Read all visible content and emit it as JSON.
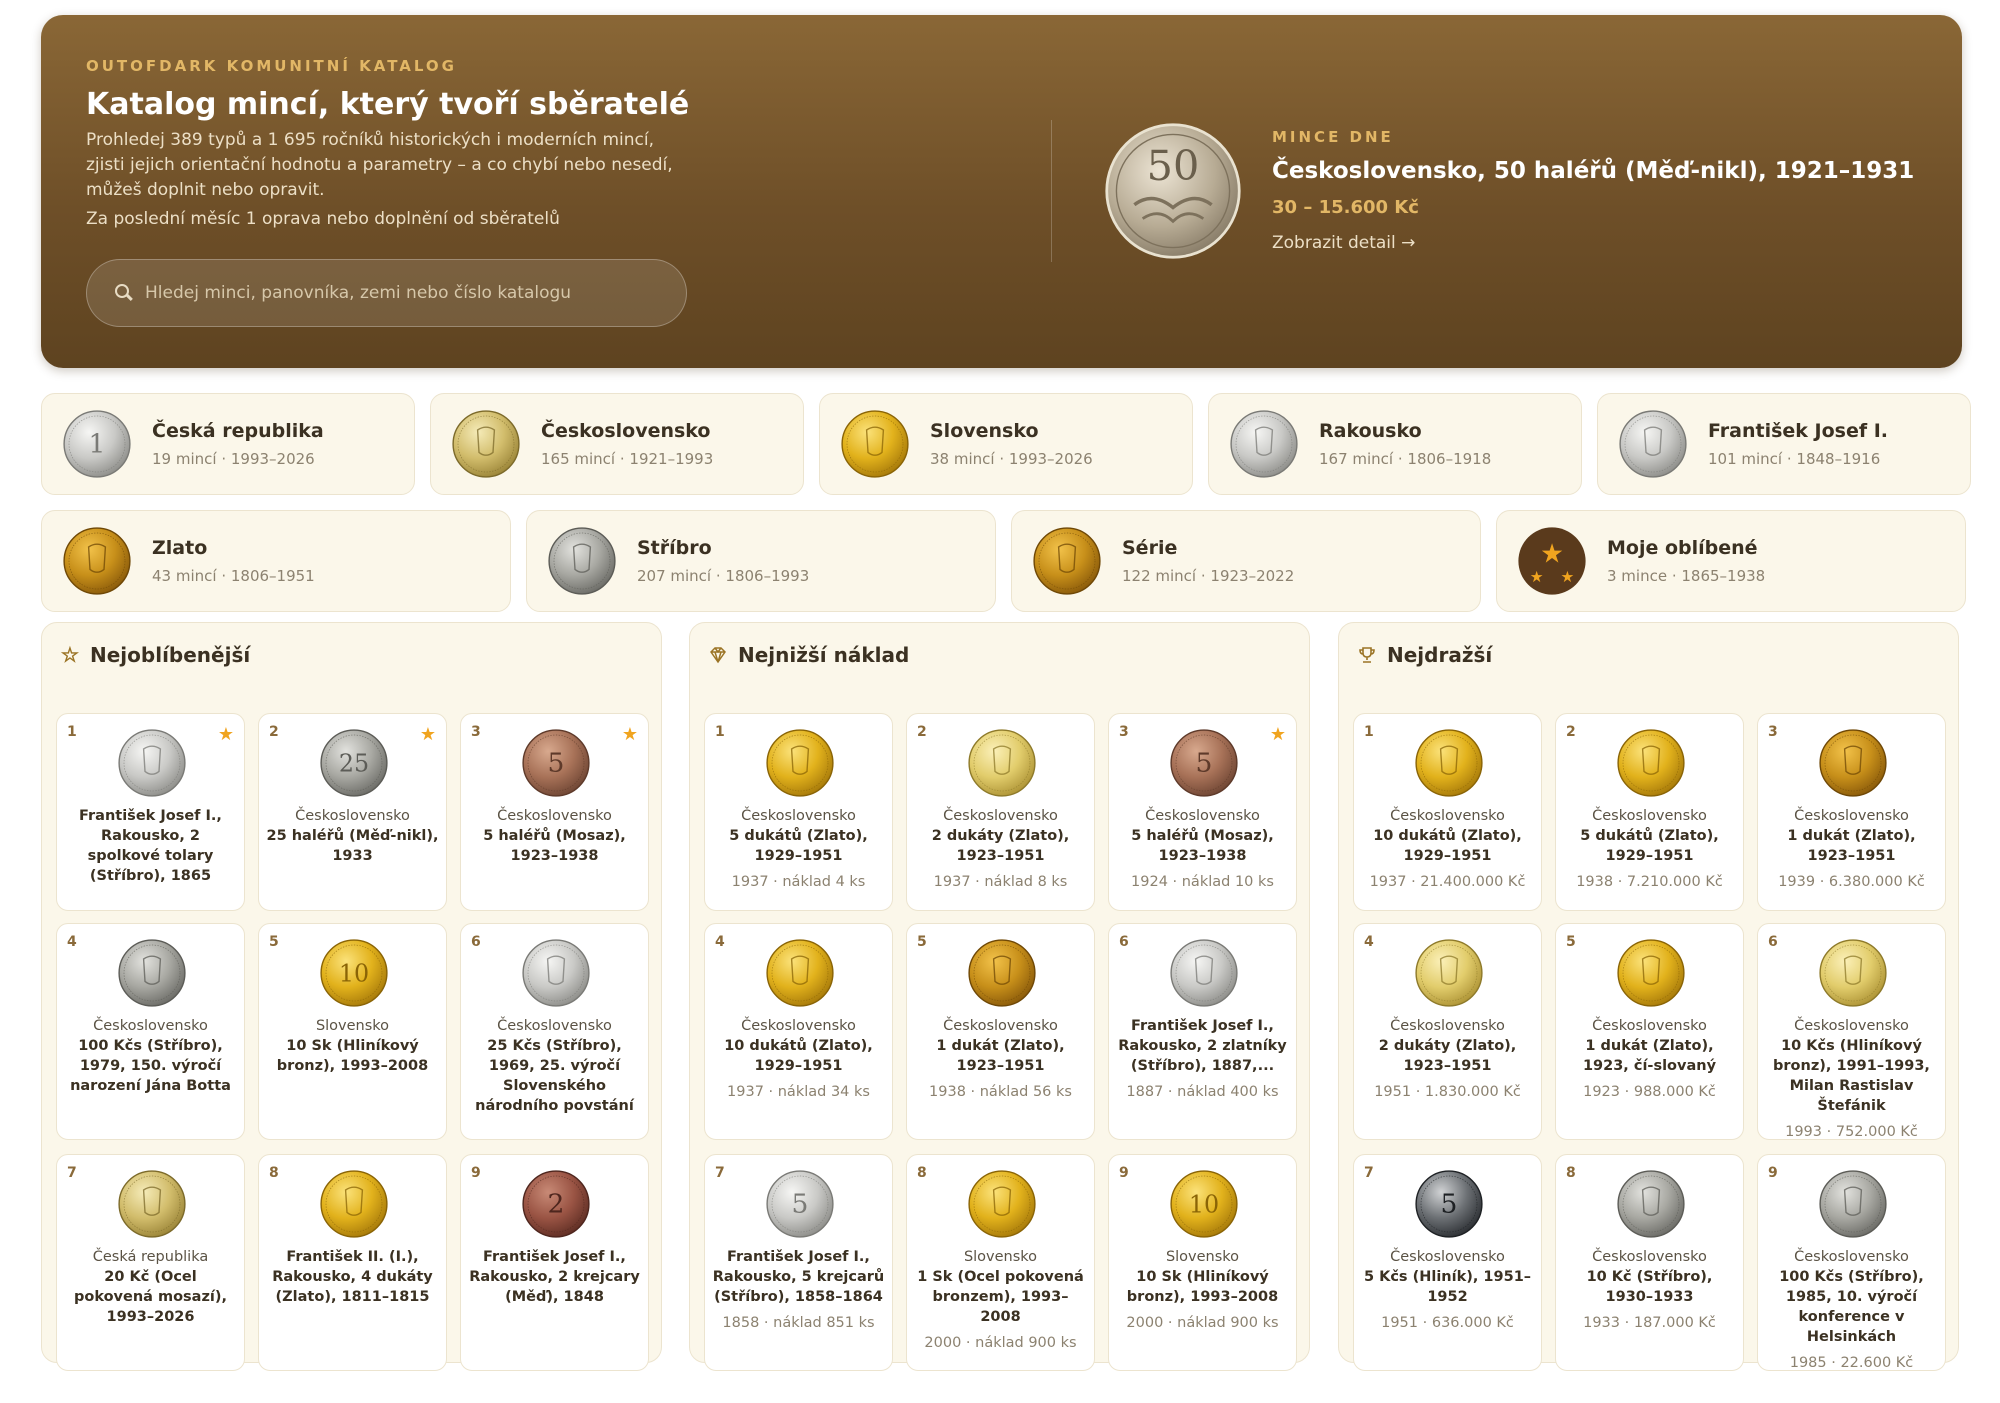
{
  "hero": {
    "eyebrow": "OUTOFDARK KOMUNITNÍ KATALOG",
    "title": "Katalog mincí, který tvoří sběratelé",
    "description": "Prohledej 389 typů a 1 695 ročníků historických i moderních mincí, zjisti jejich orientační hodnotu a parametry – a co chybí nebo nesedí, můžeš doplnit nebo opravit.",
    "note": "Za poslední měsíc 1 oprava nebo doplnění od sběratelů",
    "search_placeholder": "Hledej minci, panovníka, zemi nebo číslo katalogu"
  },
  "coin_of_day": {
    "eyebrow": "MINCE DNE",
    "title": "Československo, 50 haléřů (Měď-nikl), 1921–1931",
    "price": "30 – 15.600 Kč",
    "link": "Zobrazit detail →",
    "coin_label": "50"
  },
  "categories_row1": [
    {
      "name": "Česká republika",
      "meta": "19 mincí · 1993–2026",
      "coin": "silver",
      "label": "1"
    },
    {
      "name": "Československo",
      "meta": "165 mincí · 1921–1993",
      "coin": "brass",
      "label": ""
    },
    {
      "name": "Slovensko",
      "meta": "38 mincí · 1993–2026",
      "coin": "gold",
      "label": ""
    },
    {
      "name": "Rakousko",
      "meta": "167 mincí · 1806–1918",
      "coin": "silver",
      "label": ""
    },
    {
      "name": "František Josef I.",
      "meta": "101 mincí · 1848–1916",
      "coin": "silver",
      "label": ""
    }
  ],
  "categories_row2": [
    {
      "name": "Zlato",
      "meta": "43 mincí · 1806–1951",
      "coin": "deepgold",
      "label": ""
    },
    {
      "name": "Stříbro",
      "meta": "207 mincí · 1806–1993",
      "coin": "greysilver",
      "label": ""
    },
    {
      "name": "Série",
      "meta": "122 mincí · 1923–2022",
      "coin": "deepgold",
      "label": ""
    },
    {
      "name": "Moje oblíbené",
      "meta": "3 mince · 1865–1938",
      "coin": "favorites",
      "label": ""
    }
  ],
  "panels": [
    {
      "title": "Nejoblíbenější",
      "icon": "star-outline-icon",
      "tiles": [
        {
          "rank": "1",
          "star": true,
          "country": "",
          "name": "František Josef I., Rakousko, 2 spolkové tolary (Stříbro), 1865",
          "stat": "",
          "coin": "silver",
          "label": ""
        },
        {
          "rank": "2",
          "star": true,
          "country": "Československo",
          "name": "25 haléřů (Měď-nikl), 1933",
          "stat": "",
          "coin": "greysilver",
          "label": "25"
        },
        {
          "rank": "3",
          "star": true,
          "country": "Československo",
          "name": "5 haléřů (Mosaz), 1923–1938",
          "stat": "",
          "coin": "bronze",
          "label": "5"
        },
        {
          "rank": "4",
          "star": false,
          "country": "Československo",
          "name": "100 Kčs (Stříbro), 1979, 150. výročí narození Jána Botta",
          "stat": "",
          "coin": "greysilver",
          "label": ""
        },
        {
          "rank": "5",
          "star": false,
          "country": "Slovensko",
          "name": "10 Sk (Hliníkový bronz), 1993–2008",
          "stat": "",
          "coin": "gold",
          "label": "10"
        },
        {
          "rank": "6",
          "star": false,
          "country": "Československo",
          "name": "25 Kčs (Stříbro), 1969, 25. výročí Slovenského národního povstání",
          "stat": "",
          "coin": "silver",
          "label": ""
        },
        {
          "rank": "7",
          "star": false,
          "country": "Česká republika",
          "name": "20 Kč (Ocel pokovená mosazí), 1993–2026",
          "stat": "",
          "coin": "brass",
          "label": ""
        },
        {
          "rank": "8",
          "star": false,
          "country": "",
          "name": "František II. (I.), Rakousko, 4 dukáty (Zlato), 1811–1815",
          "stat": "",
          "coin": "gold",
          "label": ""
        },
        {
          "rank": "9",
          "star": false,
          "country": "",
          "name": "František Josef I., Rakousko, 2 krejcary (Měď), 1848",
          "stat": "",
          "coin": "copper",
          "label": "2"
        }
      ]
    },
    {
      "title": "Nejnižší náklad",
      "icon": "diamond-icon",
      "tiles": [
        {
          "rank": "1",
          "star": false,
          "country": "Československo",
          "name": "5 dukátů (Zlato), 1929–1951",
          "stat": "1937 · náklad 4 ks",
          "coin": "gold",
          "label": ""
        },
        {
          "rank": "2",
          "star": false,
          "country": "Československo",
          "name": "2 dukáty (Zlato), 1923–1951",
          "stat": "1937 · náklad 8 ks",
          "coin": "palegold",
          "label": ""
        },
        {
          "rank": "3",
          "star": true,
          "country": "Československo",
          "name": "5 haléřů (Mosaz), 1923–1938",
          "stat": "1924 · náklad 10 ks",
          "coin": "bronze",
          "label": "5"
        },
        {
          "rank": "4",
          "star": false,
          "country": "Československo",
          "name": "10 dukátů (Zlato), 1929–1951",
          "stat": "1937 · náklad 34 ks",
          "coin": "gold",
          "label": ""
        },
        {
          "rank": "5",
          "star": false,
          "country": "Československo",
          "name": "1 dukát (Zlato), 1923–1951",
          "stat": "1938 · náklad 56 ks",
          "coin": "deepgold",
          "label": ""
        },
        {
          "rank": "6",
          "star": false,
          "country": "",
          "name": "František Josef I., Rakousko, 2 zlatníky (Stříbro), 1887,...",
          "stat": "1887 · náklad 400 ks",
          "coin": "silver",
          "label": ""
        },
        {
          "rank": "7",
          "star": false,
          "country": "",
          "name": "František Josef I., Rakousko, 5 krejcarů (Stříbro), 1858–1864",
          "stat": "1858 · náklad 851 ks",
          "coin": "silver",
          "label": "5"
        },
        {
          "rank": "8",
          "star": false,
          "country": "Slovensko",
          "name": "1 Sk (Ocel pokovená bronzem), 1993–2008",
          "stat": "2000 · náklad 900 ks",
          "coin": "gold",
          "label": ""
        },
        {
          "rank": "9",
          "star": false,
          "country": "Slovensko",
          "name": "10 Sk (Hliníkový bronz), 1993–2008",
          "stat": "2000 · náklad 900 ks",
          "coin": "gold",
          "label": "10"
        }
      ]
    },
    {
      "title": "Nejdražší",
      "icon": "trophy-icon",
      "tiles": [
        {
          "rank": "1",
          "star": false,
          "country": "Československo",
          "name": "10 dukátů (Zlato), 1929–1951",
          "stat": "1937 · 21.400.000 Kč",
          "coin": "gold",
          "label": ""
        },
        {
          "rank": "2",
          "star": false,
          "country": "Československo",
          "name": "5 dukátů (Zlato), 1929–1951",
          "stat": "1938 · 7.210.000 Kč",
          "coin": "gold",
          "label": ""
        },
        {
          "rank": "3",
          "star": false,
          "country": "Československo",
          "name": "1 dukát (Zlato), 1923–1951",
          "stat": "1939 · 6.380.000 Kč",
          "coin": "deepgold",
          "label": ""
        },
        {
          "rank": "4",
          "star": false,
          "country": "Československo",
          "name": "2 dukáty (Zlato), 1923–1951",
          "stat": "1951 · 1.830.000 Kč",
          "coin": "palegold",
          "label": ""
        },
        {
          "rank": "5",
          "star": false,
          "country": "Československo",
          "name": "1 dukát (Zlato), 1923, čí-slovaný",
          "stat": "1923 · 988.000 Kč",
          "coin": "gold",
          "label": ""
        },
        {
          "rank": "6",
          "star": false,
          "country": "Československo",
          "name": "10 Kčs (Hliníkový bronz), 1991–1993, Milan Rastislav Štefánik",
          "stat": "1993 · 752.000 Kč",
          "coin": "palegold",
          "label": ""
        },
        {
          "rank": "7",
          "star": false,
          "country": "Československo",
          "name": "5 Kčs (Hliník), 1951–1952",
          "stat": "1951 · 636.000 Kč",
          "coin": "dark",
          "label": "5"
        },
        {
          "rank": "8",
          "star": false,
          "country": "Československo",
          "name": "10 Kč (Stříbro), 1930–1933",
          "stat": "1933 · 187.000 Kč",
          "coin": "greysilver",
          "label": ""
        },
        {
          "rank": "9",
          "star": false,
          "country": "Československo",
          "name": "100 Kčs (Stříbro), 1985, 10. výročí konference v Helsinkách",
          "stat": "1985 · 22.600 Kč",
          "coin": "greysilver",
          "label": ""
        }
      ]
    }
  ],
  "colors": {
    "hero_bg": "#6e4f28",
    "accent_gold": "#e2b766",
    "card_bg": "#fbf7ea",
    "star": "#f0a41f"
  }
}
